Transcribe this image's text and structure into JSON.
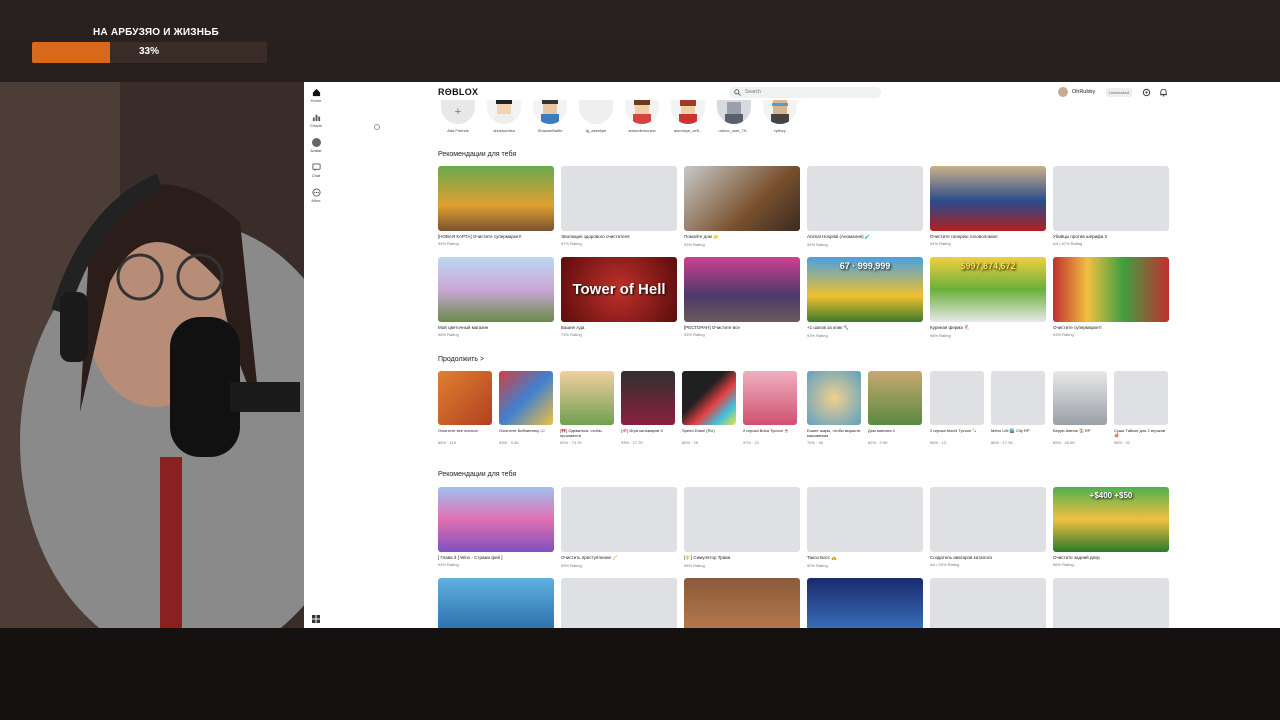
{
  "overlay": {
    "goal_title": "НА АРБУЗЯО И ЖИЗНЬБ",
    "goal_percent_text": "33%",
    "goal_progress": 0.33,
    "accent": "#d9691a"
  },
  "sidebar": {
    "items": [
      {
        "label": "Home",
        "icon": "home-icon"
      },
      {
        "label": "Charts",
        "icon": "charts-icon"
      },
      {
        "label": "Avatar",
        "icon": "avatar-icon"
      },
      {
        "label": "Chat",
        "icon": "chat-icon"
      },
      {
        "label": "More",
        "icon": "more-icon"
      }
    ]
  },
  "topbar": {
    "logo": "RΘBLOX",
    "search_placeholder": "Search",
    "username": "OhRubby",
    "badge": "Unchecked"
  },
  "friends": [
    {
      "name": "Add Friends"
    },
    {
      "name": "shushumika"
    },
    {
      "name": "ShazamBattle"
    },
    {
      "name": "tg_aeeetyie"
    },
    {
      "name": "antondemonew"
    },
    {
      "name": "alomrsye_ceff..."
    },
    {
      "name": "roblox_user_79..."
    },
    {
      "name": "rylfocy"
    }
  ],
  "sections": {
    "recommended1_title": "Рекомендации для тебя",
    "continue_title": "Продолжить >",
    "recommended2_title": "Рекомендации для тебя"
  },
  "recommended1": [
    {
      "title": "[НОВАЯ КАРТА] Очистите супермаркет!",
      "rating": "94% Rating"
    },
    {
      "title": "Эволюция здорового очистителя",
      "rating": "97% Rating"
    },
    {
      "title": "Помойте дом 🧽",
      "rating": "93% Rating"
    },
    {
      "title": "Animal Hospital (Аномалия) 🧪",
      "rating": "94% Rating"
    },
    {
      "title": "Очистите галерею головоломок!",
      "rating": "94% Rating"
    },
    {
      "title": "Убийцы против шерифа 2",
      "rating": "Ad • 87% Rating"
    },
    {
      "title": "Мой цветочный магазин",
      "rating": "96% Rating"
    },
    {
      "title": "Башня Ада",
      "rating": "73% Rating",
      "thumb_text": "Tower of Hell"
    },
    {
      "title": "[РЕСТОРАН] Очистите все",
      "rating": "93% Rating"
    },
    {
      "title": "+1 шагов за клик ⛏️",
      "rating": "93% Rating",
      "thumb_text": "67 · 999,999"
    },
    {
      "title": "Куриная ферма 🐔",
      "rating": "98% Rating",
      "thumb_text": "$997,874,672"
    },
    {
      "title": "Очистите супермаркет!",
      "rating": "93% Rating"
    }
  ],
  "continue": [
    {
      "title": "Очистите все листья!",
      "rating": "86% · 11K"
    },
    {
      "title": "Очистите Библиотеку 📖",
      "rating": "93% · 3.3K"
    },
    {
      "title": "[🎀] Одеваться, чтобы произвести",
      "rating": "90% · 73.7K"
    },
    {
      "title": "[🦑] Игра кальмаров X",
      "rating": "93% · 17.7K"
    },
    {
      "title": "Speed Draw! (RU)",
      "rating": "86% · 2K"
    },
    {
      "title": "2 игрока Boba Tycoon ☕",
      "rating": "97% · 21"
    },
    {
      "title": "Ешьте шары, чтобы вырасти массивным",
      "rating": "70% · 46"
    },
    {
      "title": "Дом магната 2",
      "rating": "82% · 2.9K"
    },
    {
      "title": "2 игрока Mochi Tycoon 🍡",
      "rating": "96% · 13"
    },
    {
      "title": "Metro Life 🏙️ City RP",
      "rating": "86% · 17.3K"
    },
    {
      "title": "Берри Авеню 🏠 RP",
      "rating": "85% · 45.5K"
    },
    {
      "title": "Суши Тайкон для 2 игроков 🍣",
      "rating": "98% · 32"
    }
  ],
  "recommended2": [
    {
      "title": "[ Глава 3 ] Winx - Стражи фей ]",
      "rating": "94% Rating"
    },
    {
      "title": "Очистить преступление 🧹",
      "rating": "93% Rating"
    },
    {
      "title": "[🌾] Симулятор Трава",
      "rating": "96% Rating"
    },
    {
      "title": "Такси Босс 🚕",
      "rating": "90% Rating"
    },
    {
      "title": "Создатель аватаров каталога",
      "rating": "Ad • 93% Rating"
    },
    {
      "title": "Очистите задний двор",
      "rating": "86% Rating",
      "thumb_text": "+$400 +$50"
    }
  ]
}
